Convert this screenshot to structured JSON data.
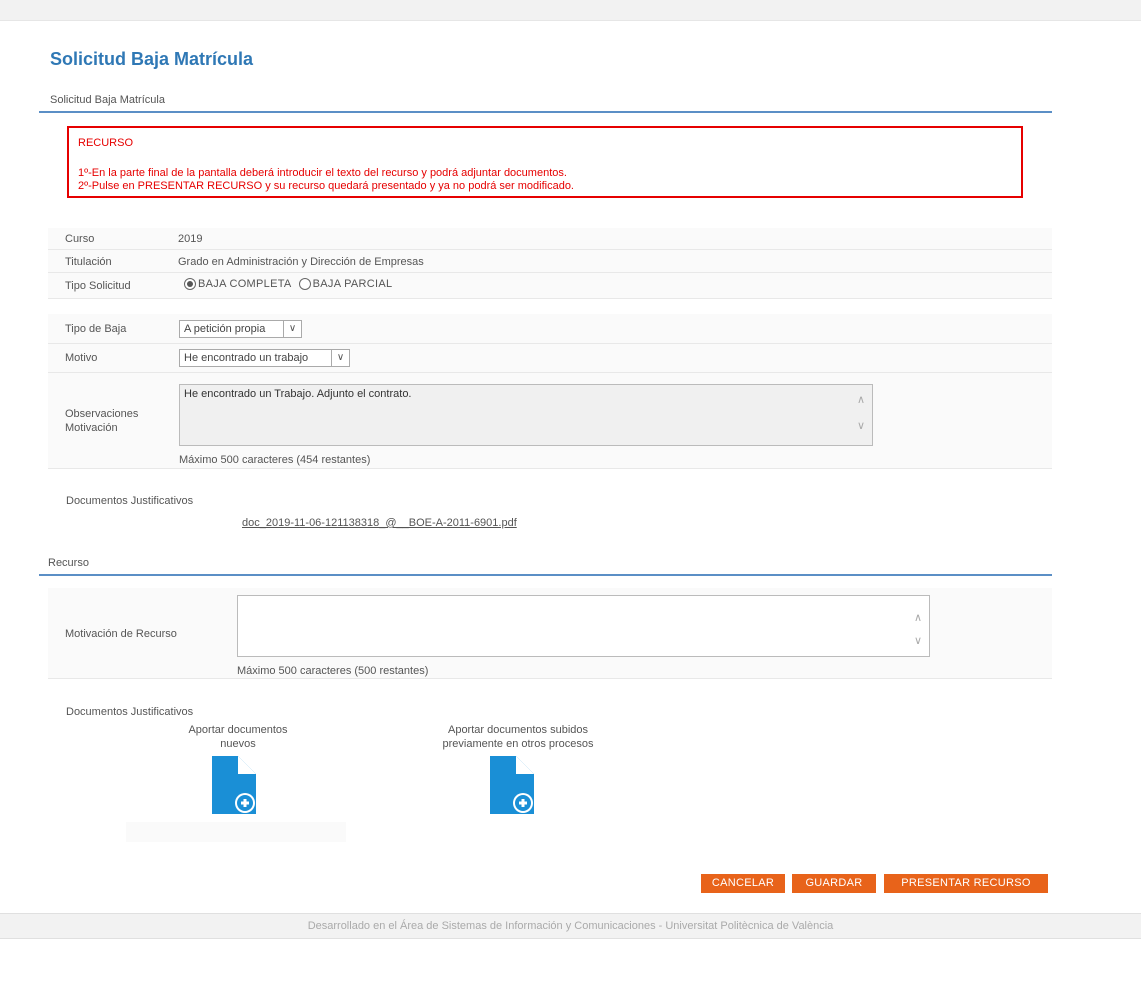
{
  "page": {
    "title": "Solicitud Baja Matrícula",
    "section_title": "Solicitud Baja Matrícula"
  },
  "notice": {
    "title": "RECURSO",
    "line1": "1º-En la parte final de la pantalla deberá introducir el texto del recurso y podrá adjuntar documentos.",
    "line2": "2º-Pulse en PRESENTAR RECURSO y su recurso quedará presentado y ya no podrá ser modificado."
  },
  "info": {
    "curso_label": "Curso",
    "curso_value": "2019",
    "titulacion_label": "Titulación",
    "titulacion_value": "Grado en Administración y Dirección de Empresas",
    "tipo_solicitud_label": "Tipo Solicitud",
    "option_completa": "BAJA COMPLETA",
    "option_parcial": "BAJA PARCIAL"
  },
  "form": {
    "tipo_baja_label": "Tipo de Baja",
    "tipo_baja_value": "A petición propia",
    "motivo_label": "Motivo",
    "motivo_value": "He encontrado un trabajo",
    "observaciones_label_1": "Observaciones",
    "observaciones_label_2": "Motivación",
    "observaciones_value": "He encontrado un Trabajo. Adjunto el contrato.",
    "observaciones_hint": "Máximo 500 caracteres (454 restantes)",
    "documentos_label": "Documentos Justificativos",
    "documento_link": "doc_2019-11-06-121138318_@__BOE-A-2011-6901.pdf"
  },
  "recurso": {
    "section_title": "Recurso",
    "motivacion_label": "Motivación de Recurso",
    "motivacion_value": "",
    "motivacion_hint": "Máximo 500 caracteres (500 restantes)",
    "documentos_label": "Documentos Justificativos",
    "nuevos_line1": "Aportar documentos",
    "nuevos_line2": "nuevos",
    "previos_line1": "Aportar documentos subidos",
    "previos_line2": "previamente en otros procesos"
  },
  "buttons": {
    "cancelar": "CANCELAR",
    "guardar": "GUARDAR",
    "presentar": "PRESENTAR RECURSO"
  },
  "footer": {
    "text": "Desarrollado en el Área de Sistemas de Información y Comunicaciones - Universitat Politècnica de València"
  },
  "colors": {
    "accent": "#2f78b5",
    "alert": "#e60000",
    "button": "#e8631a",
    "icon": "#1a8fd6"
  }
}
